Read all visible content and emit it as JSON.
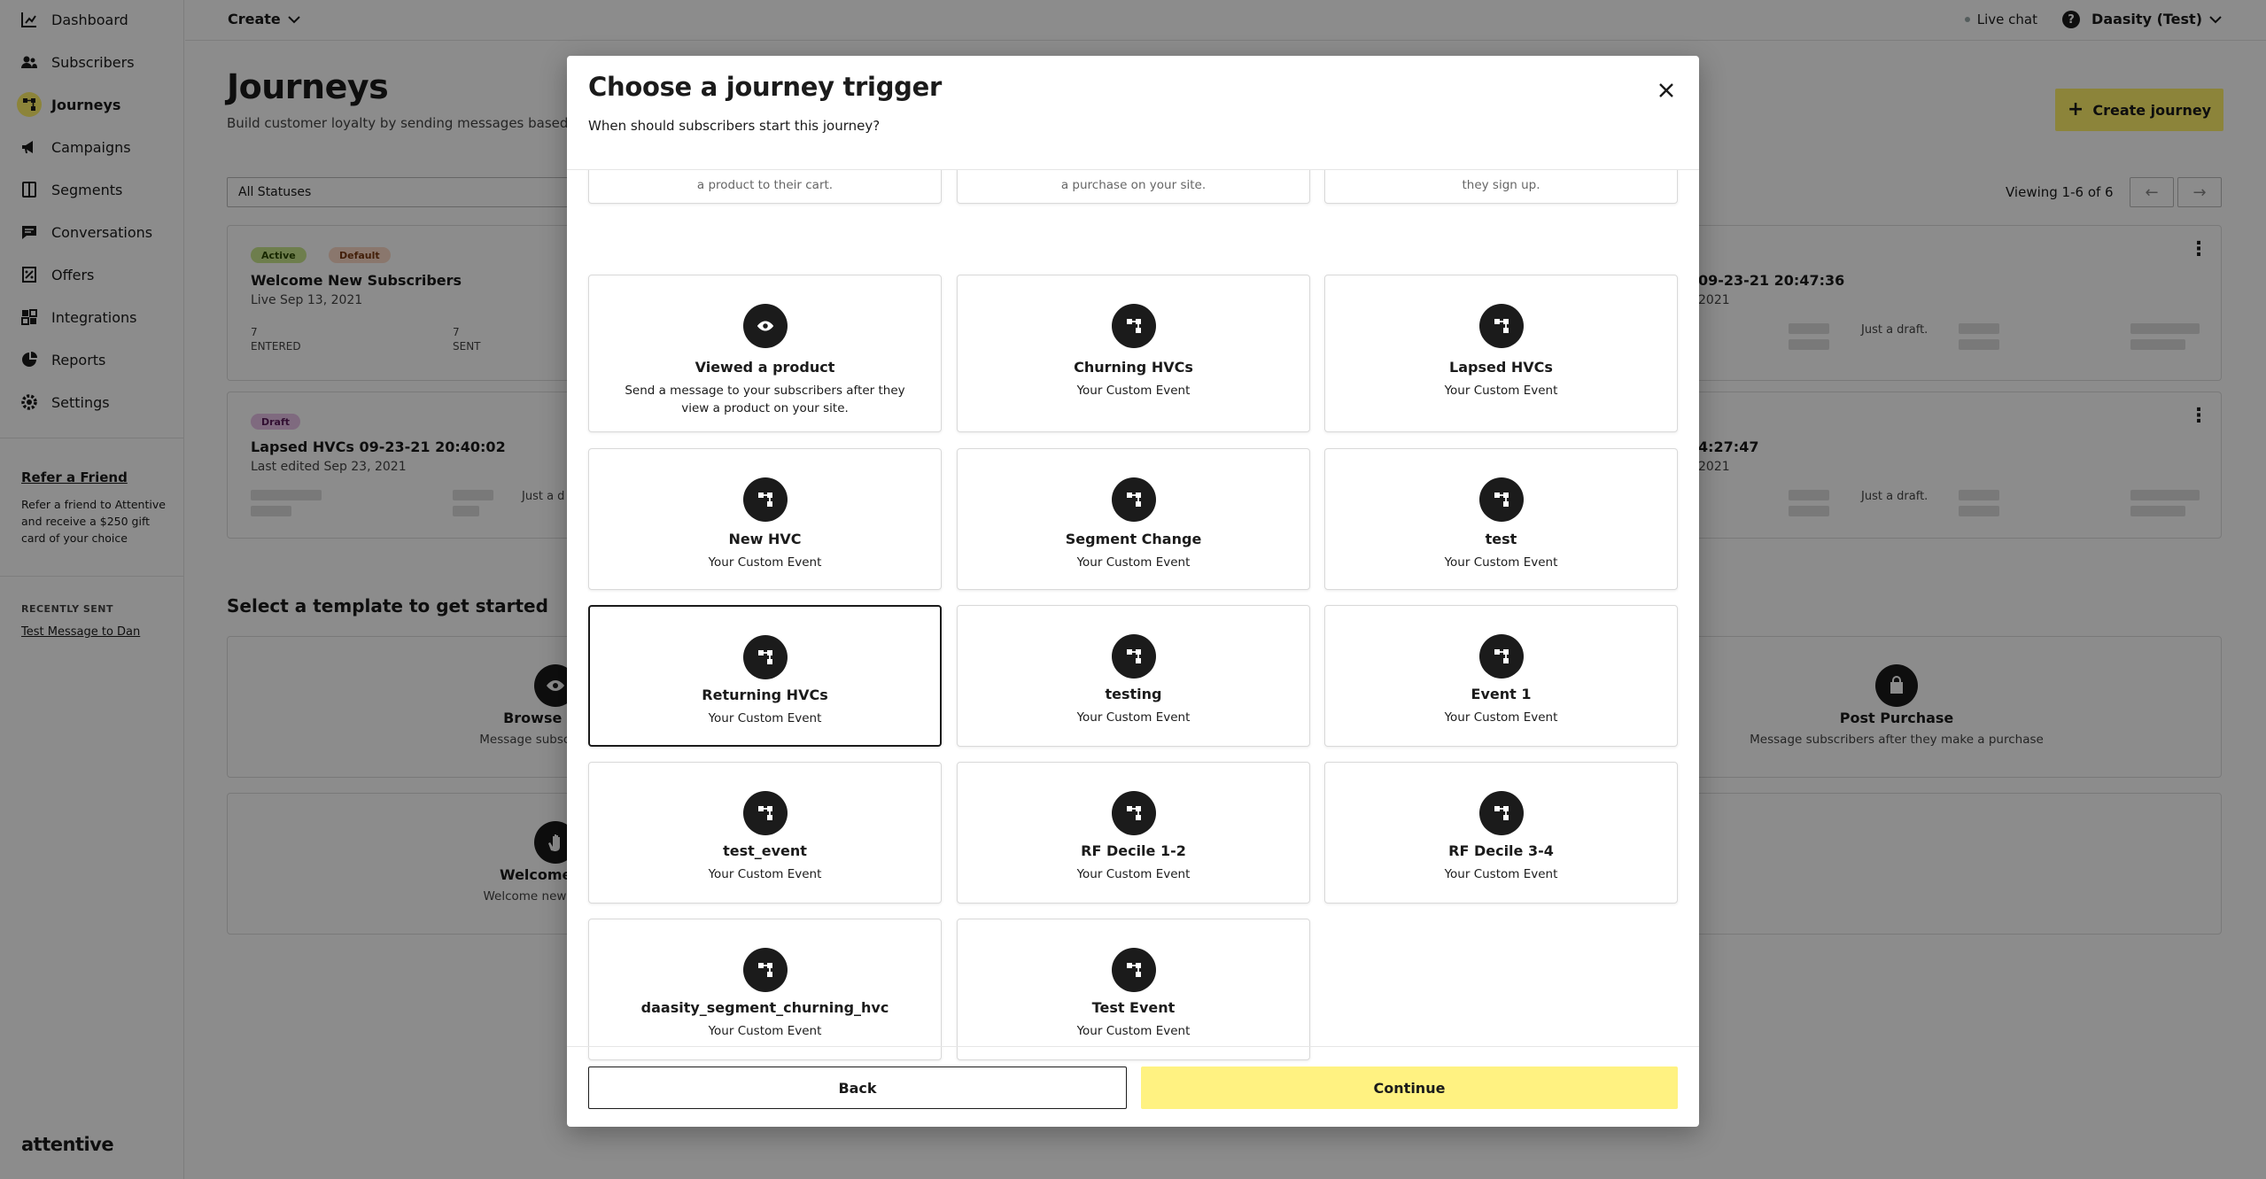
{
  "sidebar": {
    "items": [
      {
        "label": "Dashboard",
        "icon": "chart-icon"
      },
      {
        "label": "Subscribers",
        "icon": "people-icon"
      },
      {
        "label": "Journeys",
        "icon": "journey-icon",
        "active": true
      },
      {
        "label": "Campaigns",
        "icon": "megaphone-icon"
      },
      {
        "label": "Segments",
        "icon": "segments-icon"
      },
      {
        "label": "Conversations",
        "icon": "chat-icon"
      },
      {
        "label": "Offers",
        "icon": "offer-icon"
      },
      {
        "label": "Integrations",
        "icon": "integrations-icon"
      },
      {
        "label": "Reports",
        "icon": "reports-icon"
      },
      {
        "label": "Settings",
        "icon": "gear-icon"
      }
    ],
    "refer_title": "Refer a Friend",
    "refer_text": "Refer a friend to Attentive and receive a $250 gift card of your choice",
    "recent_label": "RECENTLY SENT",
    "recent_link": "Test Message to Dan",
    "logo": "attentive"
  },
  "topbar": {
    "create_label": "Create",
    "live_chat": "Live chat",
    "help": "?",
    "account": "Daasity (Test)"
  },
  "page": {
    "title": "Journeys",
    "subtitle": "Build customer loyalty by sending messages based o",
    "create_button": "Create journey",
    "status_filter": "All Statuses",
    "viewing": "Viewing 1-6 of 6"
  },
  "journeys": [
    {
      "badges": [
        "Active",
        "Default"
      ],
      "title": "Welcome New Subscribers",
      "sub": "Live Sep 13, 2021",
      "stats": [
        {
          "value": "7",
          "label": "ENTERED"
        },
        {
          "value": "7",
          "label": "SENT"
        }
      ],
      "right_title": "09-23-21 20:47:36",
      "right_sub": "2021",
      "draft_note": "Just a draft."
    },
    {
      "badges": [
        "Draft"
      ],
      "title": "Lapsed HVCs 09-23-21 20:40:02",
      "sub": "Last edited Sep 23, 2021",
      "left_note": "Just a d",
      "right_title": "4:27:47",
      "right_sub": "2021",
      "draft_note": "Just a draft."
    }
  ],
  "templates": {
    "section_title": "Select a template to get started",
    "items": [
      {
        "title": "Browse Aban",
        "sub": "Message subscribers afte",
        "icon": "eye-icon"
      },
      {
        "title": "Post Purchase",
        "sub": "Message subscribers after they make a purchase",
        "icon": "bag-icon"
      },
      {
        "title": "Welcome New",
        "sub": "Welcome new subscribe",
        "icon": "wave-icon"
      }
    ]
  },
  "modal": {
    "title": "Choose a journey trigger",
    "subtitle": "When should subscribers start this journey?",
    "partial_row": [
      {
        "desc": "a product to their cart."
      },
      {
        "desc": "a purchase on your site."
      },
      {
        "desc": "they sign up."
      }
    ],
    "triggers": [
      {
        "title": "Viewed a product",
        "desc": "Send a message to your subscribers after they view a product on your site.",
        "icon": "eye-icon"
      },
      {
        "title": "Churning HVCs",
        "desc": "Your Custom Event",
        "icon": "custom-event-icon"
      },
      {
        "title": "Lapsed HVCs",
        "desc": "Your Custom Event",
        "icon": "custom-event-icon"
      },
      {
        "title": "New HVC",
        "desc": "Your Custom Event",
        "icon": "custom-event-icon"
      },
      {
        "title": "Segment Change",
        "desc": "Your Custom Event",
        "icon": "custom-event-icon"
      },
      {
        "title": "test",
        "desc": "Your Custom Event",
        "icon": "custom-event-icon"
      },
      {
        "title": "Returning HVCs",
        "desc": "Your Custom Event",
        "icon": "custom-event-icon",
        "selected": true
      },
      {
        "title": "testing",
        "desc": "Your Custom Event",
        "icon": "custom-event-icon"
      },
      {
        "title": "Event 1",
        "desc": "Your Custom Event",
        "icon": "custom-event-icon"
      },
      {
        "title": "test_event",
        "desc": "Your Custom Event",
        "icon": "custom-event-icon"
      },
      {
        "title": "RF Decile 1-2",
        "desc": "Your Custom Event",
        "icon": "custom-event-icon"
      },
      {
        "title": "RF Decile 3-4",
        "desc": "Your Custom Event",
        "icon": "custom-event-icon"
      },
      {
        "title": "daasity_segment_churning_hvc",
        "desc": "Your Custom Event",
        "icon": "custom-event-icon"
      },
      {
        "title": "Test Event",
        "desc": "Your Custom Event",
        "icon": "custom-event-icon"
      }
    ],
    "back_label": "Back",
    "continue_label": "Continue",
    "accent_color": "#fff281"
  }
}
